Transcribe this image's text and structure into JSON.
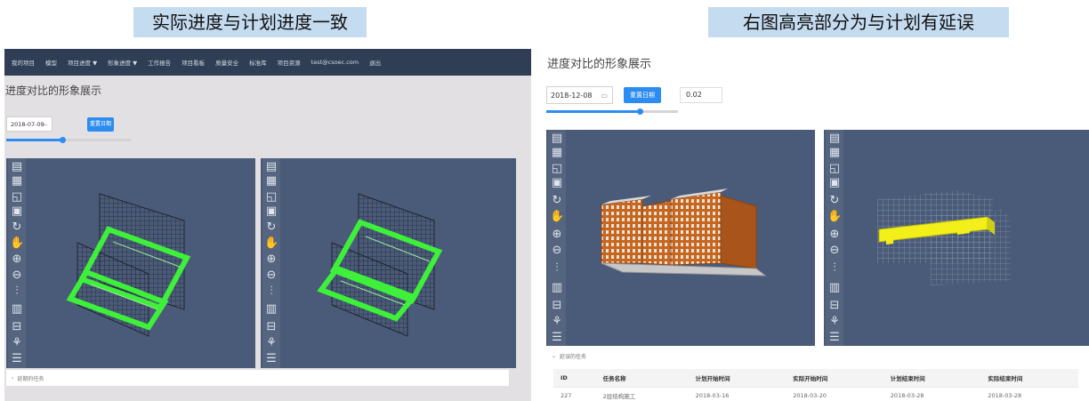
{
  "captions": {
    "left": "实际进度与计划进度一致",
    "right": "右图高亮部分为与计划有延误"
  },
  "nav": {
    "items": [
      "我的项目",
      "模型",
      "项目进度 ▼",
      "形象进度 ▼",
      "工作报告",
      "项目看板",
      "质量安全",
      "标准库",
      "项目资源",
      "test@csoec.com",
      "退出"
    ]
  },
  "left_screen": {
    "page_title": "进度对比的形象展示",
    "date": "2018-07-09",
    "reset_button": "重置日期",
    "slider_level": 0.45,
    "expander_label": "延期的任务"
  },
  "right_screen": {
    "page_title": "进度对比的形象展示",
    "date": "2018-12-08",
    "reset_button": "重置日期",
    "ratio_value": "0.02",
    "slider_level": 0.72,
    "expander_label": "延误的任务",
    "table": {
      "headers": [
        "ID",
        "任务名称",
        "计划开始时间",
        "实际开始时间",
        "计划结束时间",
        "实际结束时间"
      ],
      "rows": [
        [
          "227",
          "2层结构施工",
          "2018-03-16",
          "2018-03-20",
          "2018-03-28",
          "2018-03-28"
        ]
      ]
    }
  },
  "toolbar_icons": [
    "home-icon",
    "layers-icon",
    "window-icon",
    "box-icon",
    "rotate-icon",
    "pan-hand-icon",
    "zoom-in-icon",
    "zoom-out-icon",
    "walk-icon",
    "section-icon",
    "explode-icon",
    "tree-icon",
    "list-icon"
  ],
  "colors": {
    "nav_bg": "#2f3e55",
    "accent": "#2d8cf0",
    "viewport_bg": "#4a5b79",
    "highlight_green": "#3ef03a",
    "delay_yellow": "#f2ef1a",
    "building_orange": "#c8651f",
    "caption_bg": "#c5dbf0"
  }
}
